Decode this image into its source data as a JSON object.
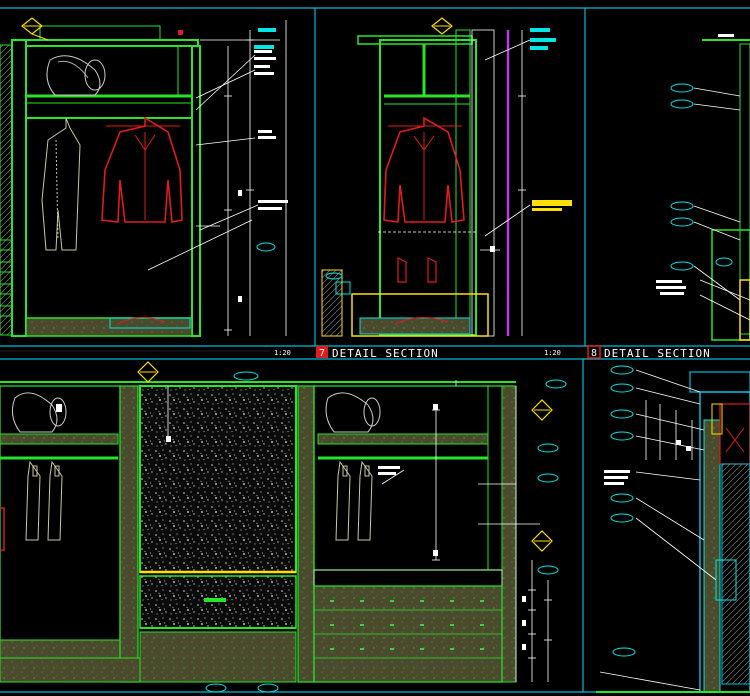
{
  "drawing": {
    "background": "#000000",
    "colors": {
      "frame": "#00bcd4",
      "cabinet": "#29e52a",
      "dim": "#ffffff",
      "garment": "#e01c1c",
      "coat": "#c8c8a0",
      "tag": "#00e5e5",
      "marker": "#ffe000",
      "purple": "#b040e0",
      "fill_olive": "#3a3a24"
    },
    "sections": [
      {
        "number": "7",
        "title": "DETAIL SECTION"
      },
      {
        "number": "8",
        "title": "DETAIL SECTION"
      }
    ],
    "scales": [
      "1:20",
      "1:20"
    ]
  }
}
